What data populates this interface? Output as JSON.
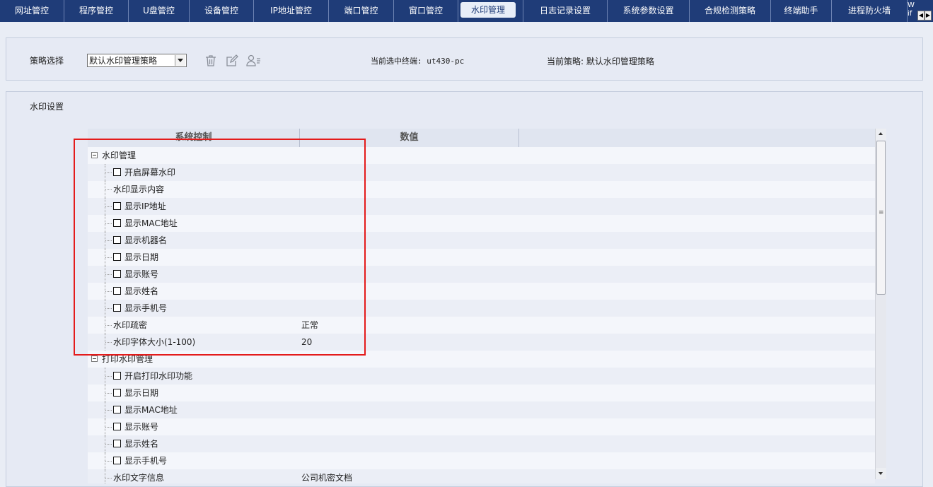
{
  "nav": {
    "tabs": [
      "网址管控",
      "程序管控",
      "U盘管控",
      "设备管控",
      "IP地址管控",
      "端口管控",
      "窗口管控",
      "水印管理",
      "日志记录设置",
      "系统参数设置",
      "合规检测策略",
      "终端助手",
      "进程防火墙"
    ],
    "active_tab": "水印管理",
    "overflow_text": "W\nif"
  },
  "policy": {
    "label": "策略选择",
    "selected": "默认水印管理策略",
    "current_terminal": "当前选中终端: ut430-pc",
    "current_policy": "当前策略: 默认水印管理策略"
  },
  "settings": {
    "title": "水印设置",
    "columns": [
      "系统控制",
      "数值"
    ],
    "rows": [
      {
        "type": "group",
        "label": "水印管理"
      },
      {
        "type": "check",
        "label": "开启屏幕水印",
        "value": ""
      },
      {
        "type": "text",
        "label": "水印显示内容",
        "value": ""
      },
      {
        "type": "check",
        "label": "显示IP地址",
        "value": ""
      },
      {
        "type": "check",
        "label": "显示MAC地址",
        "value": ""
      },
      {
        "type": "check",
        "label": "显示机器名",
        "value": ""
      },
      {
        "type": "check",
        "label": "显示日期",
        "value": ""
      },
      {
        "type": "check",
        "label": "显示账号",
        "value": ""
      },
      {
        "type": "check",
        "label": "显示姓名",
        "value": ""
      },
      {
        "type": "check",
        "label": "显示手机号",
        "value": ""
      },
      {
        "type": "text",
        "label": "水印疏密",
        "value": "正常"
      },
      {
        "type": "text",
        "label": "水印字体大小(1-100)",
        "value": "20"
      },
      {
        "type": "group",
        "label": "打印水印管理"
      },
      {
        "type": "check",
        "label": "开启打印水印功能",
        "value": ""
      },
      {
        "type": "check",
        "label": "显示日期",
        "value": ""
      },
      {
        "type": "check",
        "label": "显示MAC地址",
        "value": ""
      },
      {
        "type": "check",
        "label": "显示账号",
        "value": ""
      },
      {
        "type": "check",
        "label": "显示姓名",
        "value": ""
      },
      {
        "type": "check",
        "label": "显示手机号",
        "value": ""
      },
      {
        "type": "text",
        "label": "水印文字信息",
        "value": "公司机密文档"
      }
    ]
  },
  "colors": {
    "nav_bg": "#1f3c78",
    "highlight": "#e41b1b"
  }
}
